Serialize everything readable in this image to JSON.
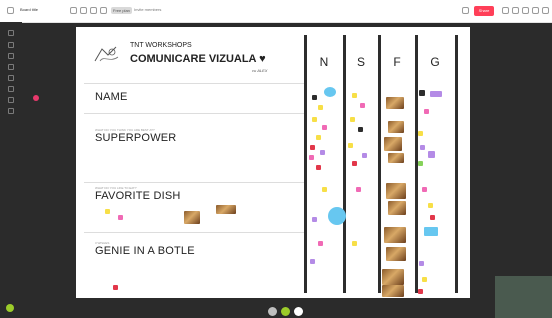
{
  "toolbar": {
    "board_name": "Board title",
    "plan_badge": "Free plan",
    "link_text": "Invite members",
    "share_label": "Share"
  },
  "board": {
    "title_line1": "TNT WORKSHOPS",
    "title_line2": "COMUNICARE VIZUALA",
    "heart_glyph": "♥",
    "signature": "cu ALEX",
    "columns": [
      "N",
      "S",
      "F",
      "G"
    ],
    "rows": [
      {
        "small": "",
        "label": "NAME"
      },
      {
        "small": "WHAT DO YOU THINK YOU ARE BEST AT?",
        "label": "SUPERPOWER"
      },
      {
        "small": "WHAT DO YOU LIKE TO EAT?",
        "label": "FAVORITE DISH"
      },
      {
        "small": "3 WISHES",
        "label": "GENIE IN A BOTLE"
      }
    ]
  },
  "colors": {
    "sticky_pink": "#f06ab5",
    "sticky_purple": "#b48be6",
    "sticky_yellow": "#f7df47",
    "sticky_blue": "#67c7f0",
    "sticky_red": "#e2374a",
    "sticky_green": "#86d25a",
    "share_button": "#ff3f58"
  },
  "icons": {
    "board_logo": "drawing-hand-icon",
    "heart": "heart-icon"
  }
}
